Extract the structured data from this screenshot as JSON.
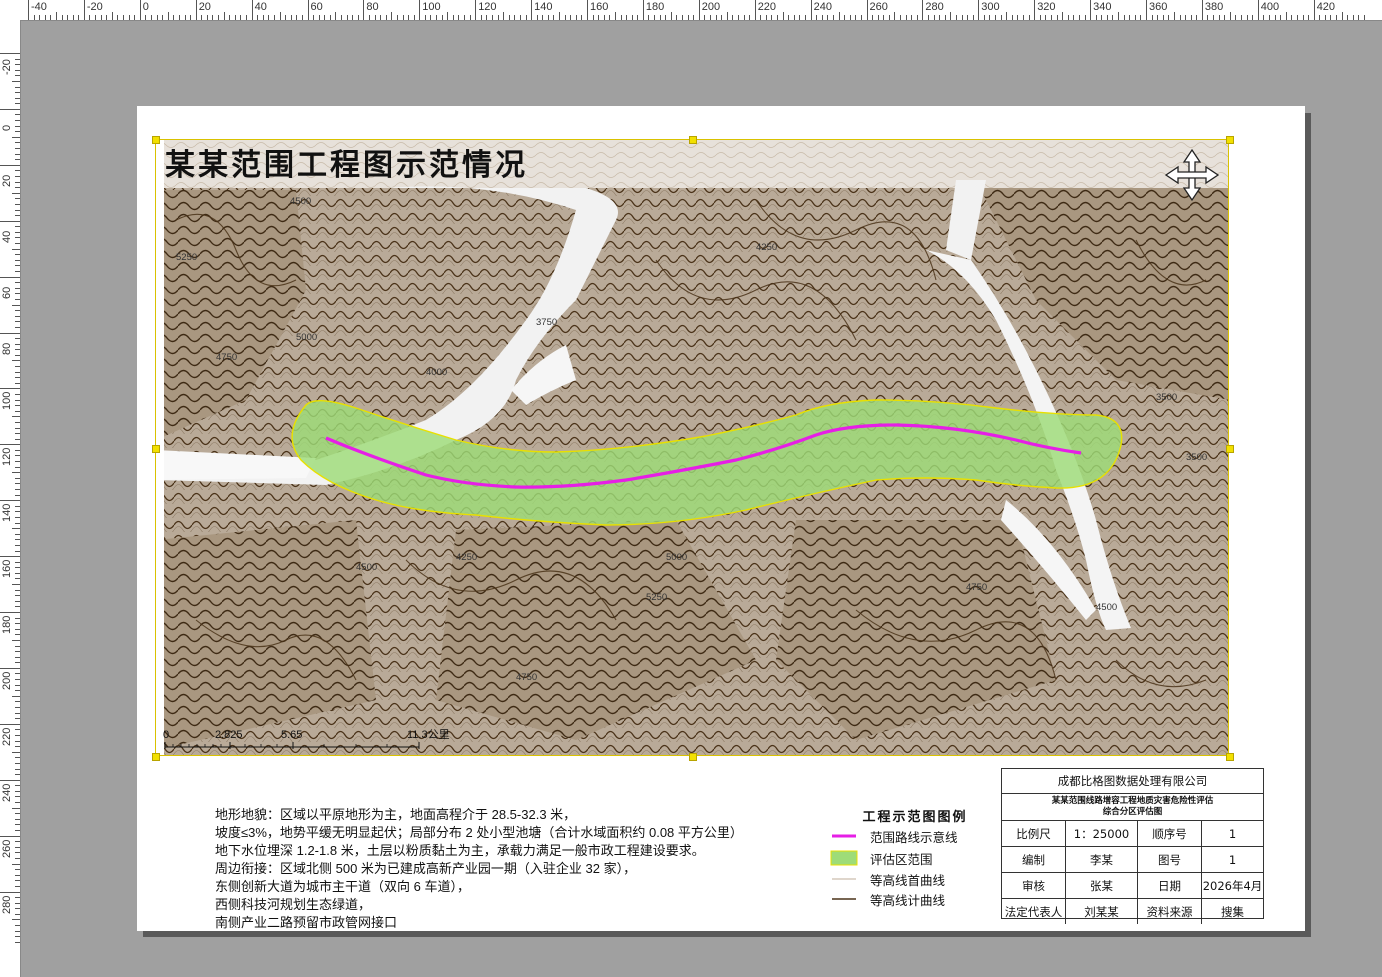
{
  "ruler": {
    "top_labels": [
      "-40",
      "-20",
      "0",
      "20",
      "40",
      "60",
      "80",
      "100",
      "120",
      "140",
      "160",
      "180",
      "200",
      "220",
      "240",
      "260",
      "280",
      "300",
      "320",
      "340",
      "360",
      "380",
      "400",
      "420"
    ],
    "left_labels": [
      "-20",
      "0",
      "20",
      "40",
      "60",
      "80",
      "100",
      "120",
      "140",
      "160",
      "180",
      "200",
      "220",
      "240",
      "260",
      "280"
    ]
  },
  "map": {
    "title": "某某范围工程图示范情况",
    "contour_labels": [
      "4500",
      "4750",
      "5000",
      "5250",
      "4250",
      "4000",
      "3750",
      "3500"
    ],
    "scale_bar": {
      "labels": [
        "0",
        "2.825",
        "5.65",
        "11.3公里"
      ]
    }
  },
  "description": {
    "lines": [
      "地形地貌：区域以平原地形为主，地面高程介于 28.5-32.3 米，",
      "坡度≤3%，地势平缓无明显起伏；局部分布 2 处小型池塘（合计水域面积约 0.08 平方公里）",
      "地下水位埋深 1.2-1.8 米，土层以粉质黏土为主，承载力满足一般市政工程建设要求。",
      "周边衔接：区域北侧 500 米为已建成高新产业园一期（入驻企业 32 家），",
      "东侧创新大道为城市主干道（双向 6 车道），",
      "西侧科技河规划生态绿道，",
      "南侧产业二路预留市政管网接口"
    ]
  },
  "legend": {
    "title": "工程示范图图例",
    "items": [
      {
        "label": "范围路线示意线",
        "color": "#e61ee6"
      },
      {
        "label": "评估区范围",
        "color": "#9edc78"
      },
      {
        "label": "等高线首曲线",
        "color": "#bfae9a"
      },
      {
        "label": "等高线计曲线",
        "color": "#4a3218"
      }
    ]
  },
  "title_block": {
    "company": "成都比格图数据处理有限公司",
    "project_line1": "某某范围线路增容工程地质灾害危险性评估",
    "project_line2": "综合分区评估图",
    "rows": [
      [
        "比例尺",
        "1：25000",
        "顺序号",
        "1"
      ],
      [
        "编制",
        "李某",
        "图号",
        "1"
      ],
      [
        "审核",
        "张某",
        "日期",
        "2026年4月"
      ],
      [
        "法定代表人",
        "刘某某",
        "资料来源",
        "搜集"
      ]
    ]
  },
  "colors": {
    "route": "#e61ee6",
    "zone_fill": "#9edc78",
    "zone_border": "#e8e000",
    "frame": "#d9c200"
  }
}
